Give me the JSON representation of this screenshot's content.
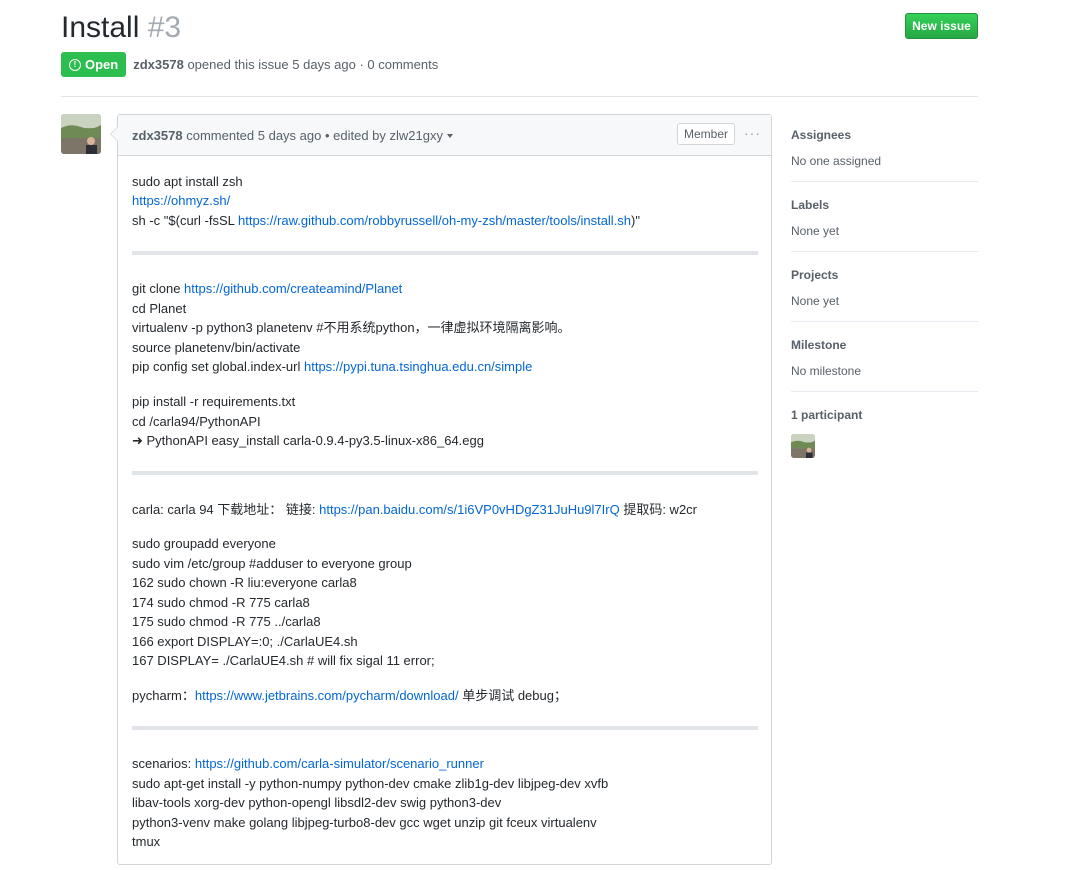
{
  "issue": {
    "title": "Install",
    "number": "#3",
    "state": "Open",
    "author": "zdx3578",
    "opened_text": "opened this issue 5 days ago · 0 comments"
  },
  "new_issue_label": "New issue",
  "comment": {
    "author": "zdx3578",
    "header_text": "commented 5 days ago • edited by zlw21gxy",
    "member_label": "Member",
    "menu_glyph": "···",
    "lines": {
      "l1": "sudo apt install zsh",
      "l2_link": "https://ohmyz.sh/",
      "l3_prefix": "sh -c \"$(curl -fsSL ",
      "l3_link": "https://raw.github.com/robbyrussell/oh-my-zsh/master/tools/install.sh",
      "l3_suffix": ")\"",
      "l4_prefix": "git clone ",
      "l4_link": "https://github.com/createamind/Planet",
      "l5": "cd Planet",
      "l6": "virtualenv -p python3 planetenv #不用系统python，一律虚拟环境隔离影响。",
      "l7": "source planetenv/bin/activate",
      "l8_prefix": "pip config set global.index-url ",
      "l8_link": "https://pypi.tuna.tsinghua.edu.cn/simple",
      "l9": "pip install -r requirements.txt",
      "l10": "cd /carla94/PythonAPI",
      "l11": "➜ PythonAPI easy_install carla-0.9.4-py3.5-linux-x86_64.egg",
      "l12_prefix": "carla: carla 94 下载地址：  链接: ",
      "l12_link": "https://pan.baidu.com/s/1i6VP0vHDgZ31JuHu9l7IrQ",
      "l12_suffix": " 提取码: w2cr",
      "l13": "sudo groupadd everyone",
      "l14": "sudo vim /etc/group #adduser to everyone group",
      "l15": "162 sudo chown -R liu:everyone carla8",
      "l16": "174 sudo chmod -R 775 carla8",
      "l17": "175 sudo chmod -R 775 ../carla8",
      "l18": "166 export DISPLAY=:0; ./CarlaUE4.sh",
      "l19": "167 DISPLAY= ./CarlaUE4.sh # will fix sigal 11 error;",
      "l20_prefix": "pycharm：",
      "l20_link": "https://www.jetbrains.com/pycharm/download/",
      "l20_suffix": " 单步调试 debug；",
      "l21_prefix": "scenarios: ",
      "l21_link": "https://github.com/carla-simulator/scenario_runner",
      "l22": "sudo apt-get install -y python-numpy python-dev cmake zlib1g-dev libjpeg-dev xvfb",
      "l23": "libav-tools xorg-dev python-opengl libsdl2-dev swig python3-dev",
      "l24": "python3-venv make golang libjpeg-turbo8-dev gcc wget unzip git fceux virtualenv",
      "l25": "tmux"
    }
  },
  "sidebar": {
    "assignees": {
      "heading": "Assignees",
      "value": "No one assigned"
    },
    "labels": {
      "heading": "Labels",
      "value": "None yet"
    },
    "projects": {
      "heading": "Projects",
      "value": "None yet"
    },
    "milestone": {
      "heading": "Milestone",
      "value": "No milestone"
    },
    "participants": {
      "heading": "1 participant"
    }
  },
  "colors": {
    "accent_green": "#2cbe4e",
    "link": "#0366d6",
    "muted": "#586069"
  }
}
